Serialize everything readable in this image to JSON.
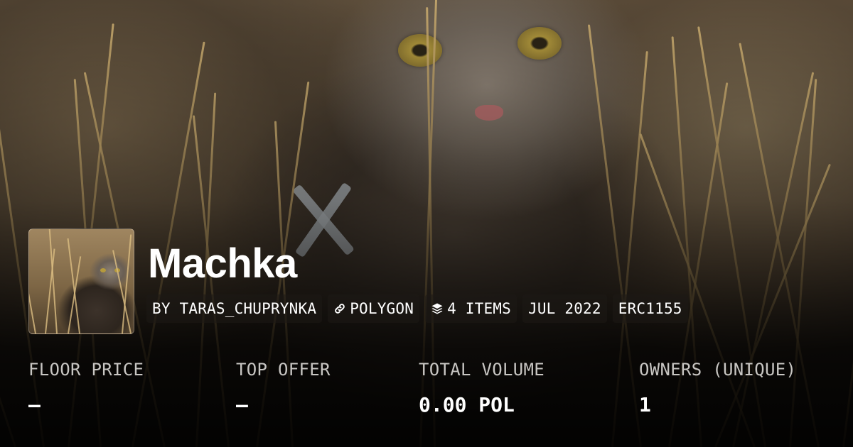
{
  "collection": {
    "name": "Machka",
    "tags": [
      {
        "label": "BY TARAS_CHUPRYNKA",
        "icon": ""
      },
      {
        "label": "POLYGON",
        "icon": "chain-link-icon"
      },
      {
        "label": "4 ITEMS",
        "icon": "layers-icon"
      },
      {
        "label": "JUL 2022",
        "icon": ""
      },
      {
        "label": "ERC1155",
        "icon": ""
      }
    ]
  },
  "stats": [
    {
      "label": "FLOOR PRICE",
      "value": "–"
    },
    {
      "label": "TOP OFFER",
      "value": "–"
    },
    {
      "label": "TOTAL VOLUME",
      "value": "0.00 POL"
    },
    {
      "label": "OWNERS (UNIQUE)",
      "value": "1"
    }
  ],
  "colors": {
    "text_primary": "#ffffff",
    "text_muted": "#c8c6c3",
    "tag_background": "rgba(30,26,22,0.55)"
  }
}
